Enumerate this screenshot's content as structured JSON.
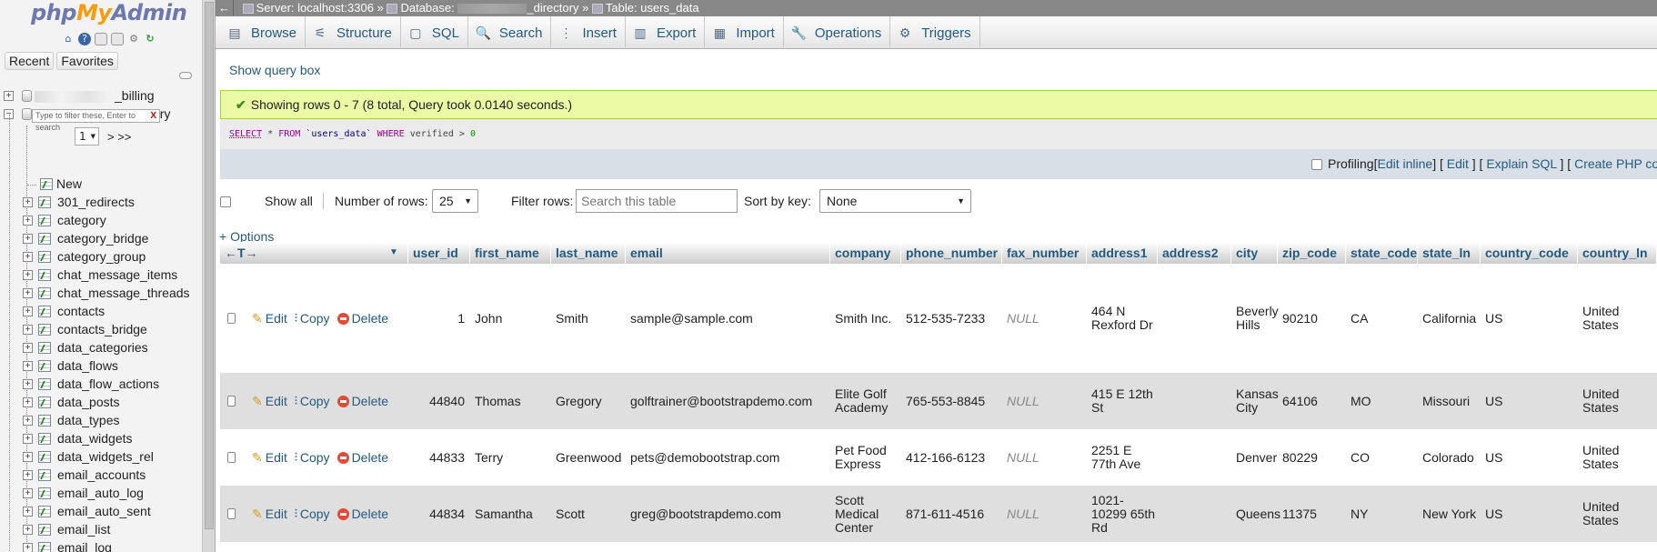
{
  "nav": {
    "logo": {
      "php": "php",
      "my": "My",
      "admin": "Admin"
    },
    "tabs": [
      "Recent",
      "Favorites"
    ],
    "databases": [
      {
        "suffix": "_billing",
        "expanded": false
      },
      {
        "suffix": "_directory",
        "expanded": true
      }
    ],
    "filter_placeholder": "Type to filter these, Enter to search",
    "filter_clear": "X",
    "page_value": "1",
    "page_next": "> >>",
    "new_label": "New",
    "tables": [
      "301_redirects",
      "category",
      "category_bridge",
      "category_group",
      "chat_message_items",
      "chat_message_threads",
      "contacts",
      "contacts_bridge",
      "data_categories",
      "data_flows",
      "data_flow_actions",
      "data_posts",
      "data_types",
      "data_widgets",
      "data_widgets_rel",
      "email_accounts",
      "email_auto_log",
      "email_auto_sent",
      "email_list",
      "email_log"
    ]
  },
  "breadcrumb": {
    "server": "Server: localhost:3306",
    "sep": "»",
    "database_prefix": "Database:",
    "database_suffix": "_directory",
    "table": "Table: users_data"
  },
  "tabs": [
    {
      "label": "Browse",
      "icon": "browse-icon",
      "glyph": "▤"
    },
    {
      "label": "Structure",
      "icon": "structure-icon",
      "glyph": "⚟"
    },
    {
      "label": "SQL",
      "icon": "sql-icon",
      "glyph": "▢"
    },
    {
      "label": "Search",
      "icon": "search-icon",
      "glyph": "🔍"
    },
    {
      "label": "Insert",
      "icon": "insert-icon",
      "glyph": "⋮"
    },
    {
      "label": "Export",
      "icon": "export-icon",
      "glyph": "▥"
    },
    {
      "label": "Import",
      "icon": "import-icon",
      "glyph": "▦"
    },
    {
      "label": "Operations",
      "icon": "wrench-icon",
      "glyph": "🔧"
    },
    {
      "label": "Triggers",
      "icon": "triggers-icon",
      "glyph": "⚙"
    }
  ],
  "show_query_box": "Show query box",
  "success_message": "Showing rows 0 - 7 (8 total, Query took 0.0140 seconds.)",
  "sql": {
    "select": "SELECT",
    "star": " * ",
    "from": "FROM",
    "table": " `users_data` ",
    "where": "WHERE",
    "cond": " verified > ",
    "value": "0"
  },
  "profiling": {
    "label": "Profiling",
    "edit_inline": "Edit inline",
    "edit": "Edit",
    "explain": "Explain SQL",
    "create_php": "Create PHP code"
  },
  "controls": {
    "show_all": "Show all",
    "number_of_rows_label": "Number of rows:",
    "number_of_rows_value": "25",
    "filter_rows_label": "Filter rows:",
    "filter_placeholder": "Search this table",
    "sort_by_key_label": "Sort by key:",
    "sort_by_key_value": "None"
  },
  "options_link": "+ Options",
  "columns": [
    "user_id",
    "first_name",
    "last_name",
    "email",
    "company",
    "phone_number",
    "fax_number",
    "address1",
    "address2",
    "city",
    "zip_code",
    "state_code",
    "state_ln",
    "country_code",
    "country_ln"
  ],
  "col_arrows": "←T→",
  "actions": {
    "edit": "Edit",
    "copy": "Copy",
    "delete": "Delete"
  },
  "rows": [
    {
      "user_id": "1",
      "first_name": "John",
      "last_name": "Smith",
      "email": "sample@sample.com",
      "company": "Smith Inc.",
      "phone_number": "512-535-7233",
      "fax_number": "NULL",
      "address1": "464 N Rexford Dr",
      "address2": "",
      "city": "Beverly Hills",
      "zip_code": "90210",
      "state_code": "CA",
      "state_ln": "California",
      "country_code": "US",
      "country_ln": "United States"
    },
    {
      "user_id": "44840",
      "first_name": "Thomas",
      "last_name": "Gregory",
      "email": "golftrainer@bootstrapdemo.com",
      "company": "Elite Golf Academy",
      "phone_number": "765-553-8845",
      "fax_number": "NULL",
      "address1": "415 E 12th St",
      "address2": "",
      "city": "Kansas City",
      "zip_code": "64106",
      "state_code": "MO",
      "state_ln": "Missouri",
      "country_code": "US",
      "country_ln": "United States"
    },
    {
      "user_id": "44833",
      "first_name": "Terry",
      "last_name": "Greenwood",
      "email": "pets@demobootstrap.com",
      "company": "Pet Food Express",
      "phone_number": "412-166-6123",
      "fax_number": "NULL",
      "address1": "2251 E 77th Ave",
      "address2": "",
      "city": "Denver",
      "zip_code": "80229",
      "state_code": "CO",
      "state_ln": "Colorado",
      "country_code": "US",
      "country_ln": "United States"
    },
    {
      "user_id": "44834",
      "first_name": "Samantha",
      "last_name": "Scott",
      "email": "greg@bootstrapdemo.com",
      "company": "Scott Medical Center",
      "phone_number": "871-611-4516",
      "fax_number": "NULL",
      "address1": "1021-10299 65th Rd",
      "address2": "",
      "city": "Queens",
      "zip_code": "11375",
      "state_code": "NY",
      "state_ln": "New York",
      "country_code": "US",
      "country_ln": "United States"
    }
  ]
}
